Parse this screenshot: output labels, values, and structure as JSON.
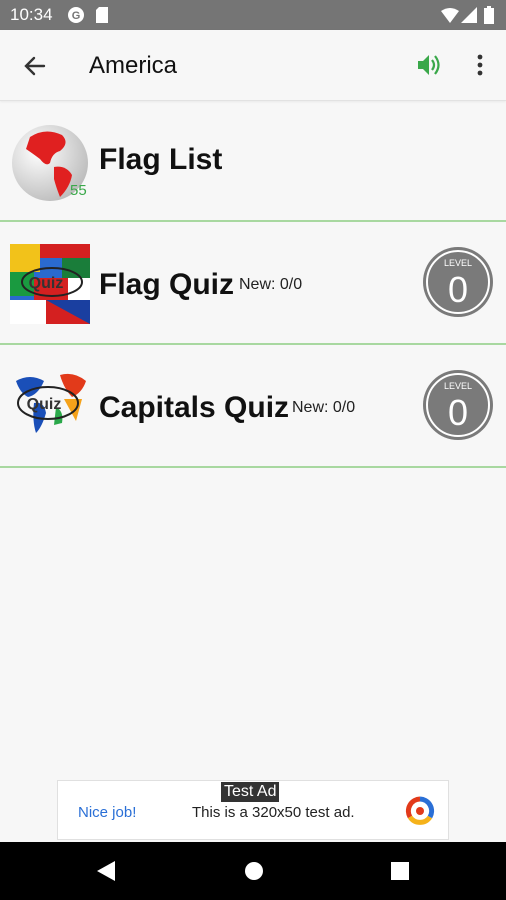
{
  "status_bar": {
    "time": "10:34",
    "icons": [
      "google-icon",
      "sd-card-icon",
      "wifi-icon",
      "signal-icon",
      "battery-icon"
    ]
  },
  "app_bar": {
    "title": "America",
    "back_icon": "arrow-back-icon",
    "sound_icon": "volume-on-icon",
    "menu_icon": "more-vert-icon",
    "accent_color": "#3aa84a"
  },
  "rows": [
    {
      "title": "Flag List",
      "badge_count": "55"
    },
    {
      "title": "Flag Quiz",
      "new_count": "New: 0/0",
      "level_label": "LEVEL",
      "level_value": "0",
      "thumb_text": "Quiz"
    },
    {
      "title": "Capitals Quiz",
      "new_count": "New: 0/0",
      "level_label": "LEVEL",
      "level_value": "0",
      "thumb_text": "Quiz"
    }
  ],
  "ad": {
    "badge": "Test Ad",
    "headline": "Nice job!",
    "description": "This is a 320x50 test ad."
  },
  "nav_bar": {
    "buttons": [
      "back-triangle-icon",
      "home-circle-icon",
      "recents-square-icon"
    ]
  }
}
